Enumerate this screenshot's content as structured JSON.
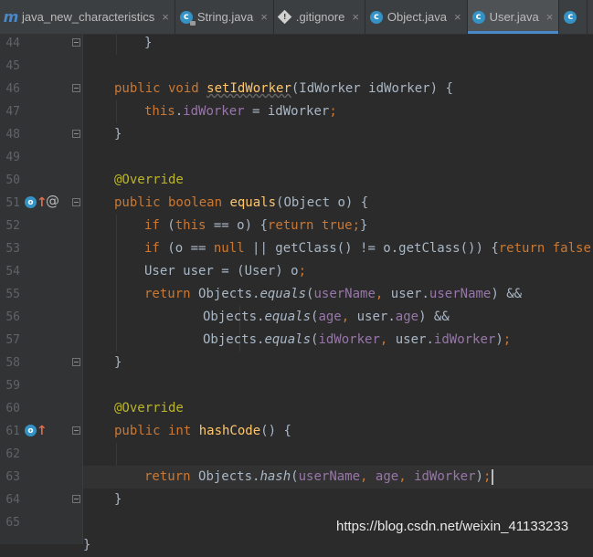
{
  "tabs": [
    {
      "label": "java_new_characteristics",
      "icon": "module-icon",
      "closable": true,
      "active": false
    },
    {
      "label": "String.java",
      "icon": "class-locked-icon",
      "closable": true,
      "active": false
    },
    {
      "label": ".gitignore",
      "icon": "gitignore-icon",
      "closable": true,
      "active": false
    },
    {
      "label": "Object.java",
      "icon": "class-icon",
      "closable": true,
      "active": false
    },
    {
      "label": "User.java",
      "icon": "class-icon",
      "closable": true,
      "active": true
    },
    {
      "label": "",
      "icon": "class-icon",
      "closable": false,
      "active": false
    }
  ],
  "colors": {
    "background": "#2b2b2b",
    "gutter": "#313335",
    "keyword": "#cc7832",
    "method": "#ffc66d",
    "field": "#9876aa",
    "annotation": "#bbb529",
    "text": "#a9b7c6",
    "line_number": "#606366",
    "active_tab_indicator": "#4a88c7"
  },
  "lines": [
    {
      "n": "44",
      "fold": "close",
      "indent": 1,
      "tokens": [
        [
          "}",
          "t"
        ]
      ]
    },
    {
      "n": "45",
      "indent": 0,
      "tokens": []
    },
    {
      "n": "46",
      "fold": "open",
      "indent": 0,
      "tokens": [
        [
          "public void ",
          "k"
        ],
        [
          "setIdWorker",
          "mu"
        ],
        [
          "(IdWorker idWorker) {",
          "t"
        ]
      ]
    },
    {
      "n": "47",
      "indent": 1,
      "tokens": [
        [
          "this",
          "k"
        ],
        [
          ".",
          "t"
        ],
        [
          "idWorker",
          "f"
        ],
        [
          " = idWorker",
          "t"
        ],
        [
          ";",
          "k"
        ]
      ]
    },
    {
      "n": "48",
      "fold": "close",
      "indent": 0,
      "tokens": [
        [
          "}",
          "t"
        ]
      ]
    },
    {
      "n": "49",
      "indent": 0,
      "tokens": []
    },
    {
      "n": "50",
      "indent": 0,
      "tokens": [
        [
          "@Override",
          "a"
        ]
      ]
    },
    {
      "n": "51",
      "fold": "open",
      "icons": [
        "override",
        "at"
      ],
      "indent": 0,
      "tokens": [
        [
          "public boolean ",
          "k"
        ],
        [
          "equals",
          "m"
        ],
        [
          "(Object o) {",
          "t"
        ]
      ]
    },
    {
      "n": "52",
      "indent": 1,
      "tokens": [
        [
          "if ",
          "k"
        ],
        [
          "(",
          "t"
        ],
        [
          "this",
          "k"
        ],
        [
          " == o) {",
          "t"
        ],
        [
          "return true;",
          "k"
        ],
        [
          "}",
          "t"
        ]
      ]
    },
    {
      "n": "53",
      "indent": 1,
      "tokens": [
        [
          "if ",
          "k"
        ],
        [
          "(o == ",
          "t"
        ],
        [
          "null",
          "k"
        ],
        [
          " || getClass() != o.getClass()) {",
          "t"
        ],
        [
          "return false;",
          "k"
        ],
        [
          "}",
          "t"
        ]
      ]
    },
    {
      "n": "54",
      "indent": 1,
      "tokens": [
        [
          "User user = (User) o",
          "t"
        ],
        [
          ";",
          "k"
        ]
      ]
    },
    {
      "n": "55",
      "indent": 1,
      "tokens": [
        [
          "return ",
          "k"
        ],
        [
          "Objects.",
          "t"
        ],
        [
          "equals",
          "i"
        ],
        [
          "(",
          "t"
        ],
        [
          "userName",
          "f"
        ],
        [
          ", ",
          "k"
        ],
        [
          "user.",
          "t"
        ],
        [
          "userName",
          "f"
        ],
        [
          ") &&",
          "t"
        ]
      ]
    },
    {
      "n": "56",
      "indent": 3,
      "tokens": [
        [
          "Objects.",
          "t"
        ],
        [
          "equals",
          "i"
        ],
        [
          "(",
          "t"
        ],
        [
          "age",
          "f"
        ],
        [
          ", ",
          "k"
        ],
        [
          "user.",
          "t"
        ],
        [
          "age",
          "f"
        ],
        [
          ") &&",
          "t"
        ]
      ]
    },
    {
      "n": "57",
      "indent": 3,
      "tokens": [
        [
          "Objects.",
          "t"
        ],
        [
          "equals",
          "i"
        ],
        [
          "(",
          "t"
        ],
        [
          "idWorker",
          "f"
        ],
        [
          ", ",
          "k"
        ],
        [
          "user.",
          "t"
        ],
        [
          "idWorker",
          "f"
        ],
        [
          ")",
          "t"
        ],
        [
          ";",
          "k"
        ]
      ]
    },
    {
      "n": "58",
      "fold": "close",
      "indent": 0,
      "tokens": [
        [
          "}",
          "t"
        ]
      ]
    },
    {
      "n": "59",
      "indent": 0,
      "tokens": []
    },
    {
      "n": "60",
      "indent": 0,
      "tokens": [
        [
          "@Override",
          "a"
        ]
      ]
    },
    {
      "n": "61",
      "fold": "open",
      "icons": [
        "override"
      ],
      "indent": 0,
      "tokens": [
        [
          "public int ",
          "k"
        ],
        [
          "hashCode",
          "m"
        ],
        [
          "() {",
          "t"
        ]
      ]
    },
    {
      "n": "62",
      "indent": 0,
      "tokens": []
    },
    {
      "n": "63",
      "current": true,
      "caret": true,
      "indent": 1,
      "tokens": [
        [
          "return ",
          "k"
        ],
        [
          "Objects.",
          "t"
        ],
        [
          "hash",
          "i"
        ],
        [
          "(",
          "t"
        ],
        [
          "userName",
          "f"
        ],
        [
          ", ",
          "k"
        ],
        [
          "age",
          "f"
        ],
        [
          ", ",
          "k"
        ],
        [
          "idWorker",
          "f"
        ],
        [
          ")",
          "t"
        ],
        [
          ";",
          "k"
        ]
      ]
    },
    {
      "n": "64",
      "fold": "close",
      "indent": 0,
      "tokens": [
        [
          "}",
          "t"
        ]
      ]
    },
    {
      "n": "65",
      "indent": 0,
      "tokens": []
    },
    {
      "n": "",
      "indent": -1,
      "tokens": [
        [
          "}",
          "t"
        ]
      ]
    }
  ],
  "watermark": "https://blog.csdn.net/weixin_41133233"
}
